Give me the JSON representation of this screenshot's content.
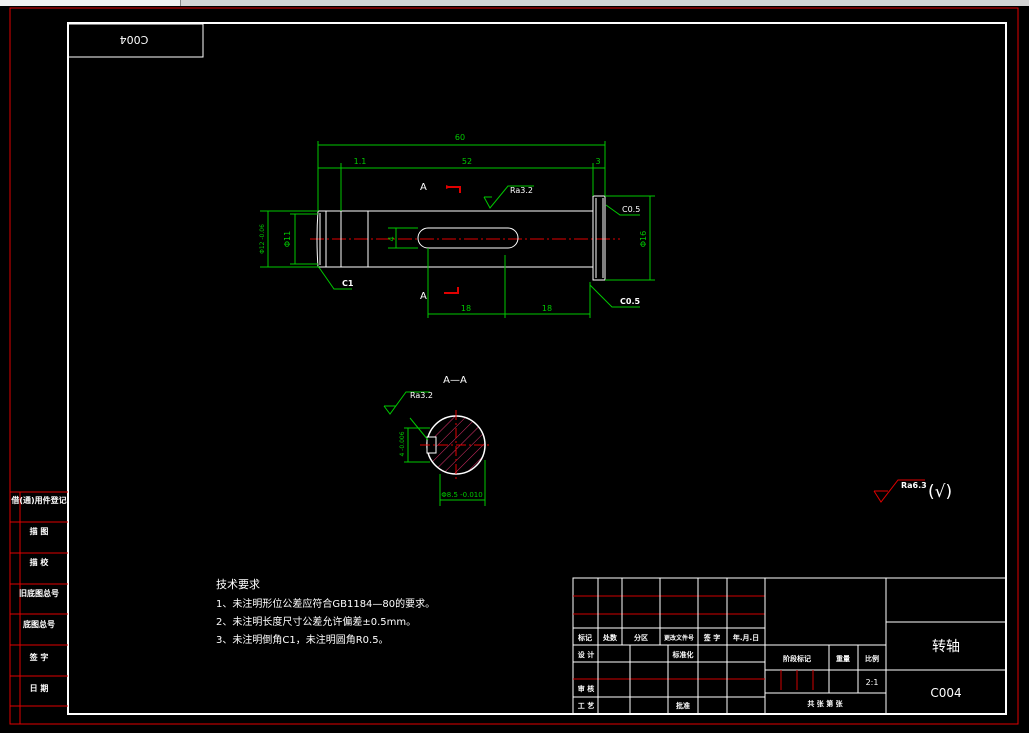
{
  "drawing": {
    "code_rotated": "C004",
    "part_name": "转轴",
    "part_code": "C004",
    "scale": "2:1"
  },
  "dimensions": {
    "overall": "60",
    "middle": "52",
    "left_step": "1.1",
    "right_step": "3",
    "keyway_left": "18",
    "keyway_right": "18",
    "dia_left": "Φ11",
    "dia_left_outer": "Φ12 -0.06",
    "dia_right": "Φ16",
    "key_width": "4",
    "section_depth": "4 -0.006",
    "section_dia": "Φ8.5 -0.010"
  },
  "annotations": {
    "view_label_top": "A",
    "view_label_bottom": "A",
    "section_title": "A—A",
    "roughness_main": "Ra3.2",
    "roughness_section": "Ra3.2",
    "roughness_general": "Ra6.3",
    "roughness_check": "(√)",
    "chamfer_left": "C1",
    "chamfer_right_top": "C0.5",
    "chamfer_right_bottom": "C0.5"
  },
  "tech_requirements": {
    "title": "技术要求",
    "items": [
      "1、未注明形位公差应符合GB1184—80的要求。",
      "2、未注明长度尺寸公差允许偏差±0.5mm。",
      "3、未注明倒角C1，未注明圆角R0.5。"
    ]
  },
  "left_stamp_labels": [
    "借(通)用件登记",
    "描  图",
    "描  校",
    "旧底图总号",
    "底图总号",
    "签  字",
    "日  期"
  ],
  "title_block": {
    "row_headers": [
      "标记",
      "处数",
      "分区",
      "更改文件号",
      "签 字",
      "年.月.日"
    ],
    "design": "设 计",
    "standardize": "标准化",
    "review": "审 核",
    "process": "工 艺",
    "approve": "批准",
    "stage_mark": "阶段标记",
    "weight": "重量",
    "scale_label": "比例",
    "sheet_info": "共  张  第  张"
  },
  "colors": {
    "geometry": "#ffffff",
    "dimension": "#00c800",
    "frame_outer": "#e00000",
    "center_line": "#e00000",
    "hatch": "#e0306a",
    "title_grid": "#d00000"
  }
}
